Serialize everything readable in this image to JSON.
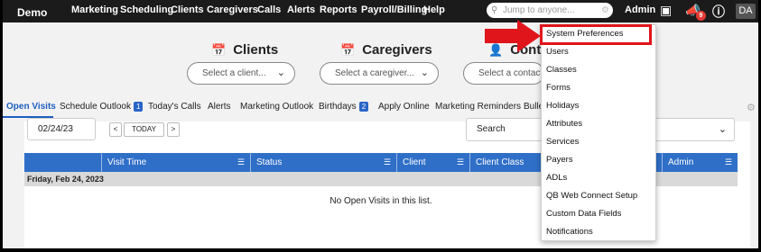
{
  "topnav": {
    "brand": "Demo",
    "items": [
      "Marketing",
      "Scheduling",
      "Clients",
      "Caregivers",
      "Calls",
      "Alerts",
      "Reports",
      "Payroll/Billing",
      "Help"
    ],
    "search_placeholder": "Jump to anyone...",
    "admin_label": "Admin",
    "notification_count": "9",
    "avatar_initials": "DA"
  },
  "sections": {
    "clients_title": "Clients",
    "clients_placeholder": "Select a client...",
    "caregivers_title": "Caregivers",
    "caregivers_placeholder": "Select a caregiver...",
    "contacts_title": "Contac",
    "contacts_placeholder": "Select a contact"
  },
  "tabs": [
    {
      "label": "Open Visits"
    },
    {
      "label": "Schedule Outlook",
      "count": "1"
    },
    {
      "label": "Today's Calls"
    },
    {
      "label": "Alerts"
    },
    {
      "label": "Marketing Outlook"
    },
    {
      "label": "Birthdays",
      "count": "2"
    },
    {
      "label": "Apply Online"
    },
    {
      "label": "Marketing Reminders"
    },
    {
      "label": "Bulle"
    }
  ],
  "filters": {
    "date_value": "02/24/23",
    "prev": "<",
    "today": "TODAY",
    "next": ">",
    "search_label": "Search"
  },
  "table": {
    "columns": [
      "Visit Time",
      "Status",
      "Client",
      "Client Class",
      "Admin"
    ],
    "date_row": "Friday, Feb 24, 2023",
    "empty_message": "No Open Visits in this list."
  },
  "admin_menu": {
    "items": [
      "System Preferences",
      "Users",
      "Classes",
      "Forms",
      "Holidays",
      "Attributes",
      "Services",
      "Payers",
      "ADLs",
      "QB Web Connect Setup",
      "Custom Data Fields",
      "Notifications"
    ],
    "highlighted": "System Preferences"
  },
  "colors": {
    "nav_bg": "#1b1b1b",
    "accent_blue": "#2f6fc8",
    "highlight_red": "#e0151b"
  }
}
